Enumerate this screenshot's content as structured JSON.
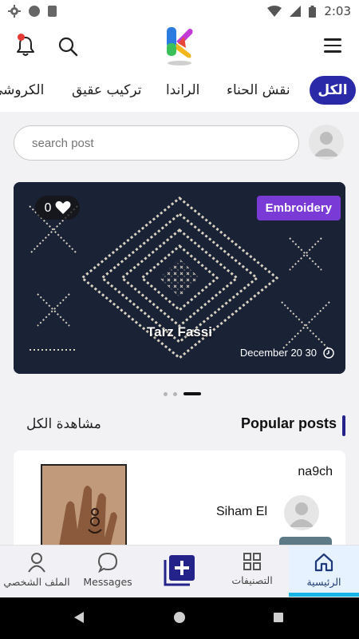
{
  "status_bar": {
    "time": "2:03"
  },
  "tabs": [
    {
      "label": "الكل",
      "active": true
    },
    {
      "label": "نقش الحناء"
    },
    {
      "label": "الراندا"
    },
    {
      "label": "تركيب عقيق"
    },
    {
      "label": "الكروشي"
    }
  ],
  "search": {
    "placeholder": "search post"
  },
  "featured": {
    "likes": "0",
    "category": "Embroidery",
    "title": "Tarz Fassi",
    "date": "December 20 30"
  },
  "section": {
    "title": "Popular posts",
    "view_all": "مشاهدة الكل"
  },
  "post": {
    "handle": "na9ch",
    "author": "Siham El"
  },
  "bottom_nav": {
    "home": "الرئيسية",
    "categories": "التصنيفات",
    "messages": "Messages",
    "profile": "الملف الشخصي"
  },
  "colors": {
    "accent": "#2a2aa8",
    "badge": "#7a3ad6",
    "home_highlight": "#18b4e6"
  }
}
